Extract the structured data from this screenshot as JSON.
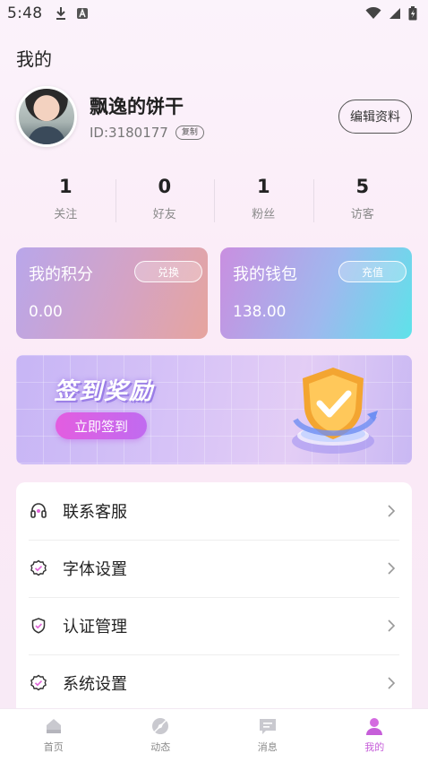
{
  "status_bar": {
    "time": "5:48"
  },
  "page": {
    "title": "我的"
  },
  "profile": {
    "username": "飘逸的饼干",
    "user_id": "ID:3180177",
    "copy_label": "复制",
    "edit_label": "编辑资料"
  },
  "stats": [
    {
      "value": "1",
      "label": "关注"
    },
    {
      "value": "0",
      "label": "好友"
    },
    {
      "value": "1",
      "label": "粉丝"
    },
    {
      "value": "5",
      "label": "访客"
    }
  ],
  "cards": {
    "points": {
      "title": "我的积分",
      "amount": "0.00",
      "button": "兑换"
    },
    "wallet": {
      "title": "我的钱包",
      "amount": "138.00",
      "button": "充值"
    }
  },
  "banner": {
    "title": "签到奖励",
    "button": "立即签到"
  },
  "menu": [
    {
      "label": "联系客服",
      "icon": "headset-icon"
    },
    {
      "label": "字体设置",
      "icon": "badge-check-icon"
    },
    {
      "label": "认证管理",
      "icon": "shield-check-icon"
    },
    {
      "label": "系统设置",
      "icon": "gear-check-icon"
    }
  ],
  "tabbar": [
    {
      "label": "首页",
      "icon": "home-icon",
      "active": false
    },
    {
      "label": "动态",
      "icon": "compass-icon",
      "active": false
    },
    {
      "label": "消息",
      "icon": "message-icon",
      "active": false
    },
    {
      "label": "我的",
      "icon": "person-icon",
      "active": true
    }
  ],
  "colors": {
    "accent": "#c65ed9",
    "banner_button": "#e35de0",
    "wallet_gradient_end": "#5ee2ea"
  }
}
